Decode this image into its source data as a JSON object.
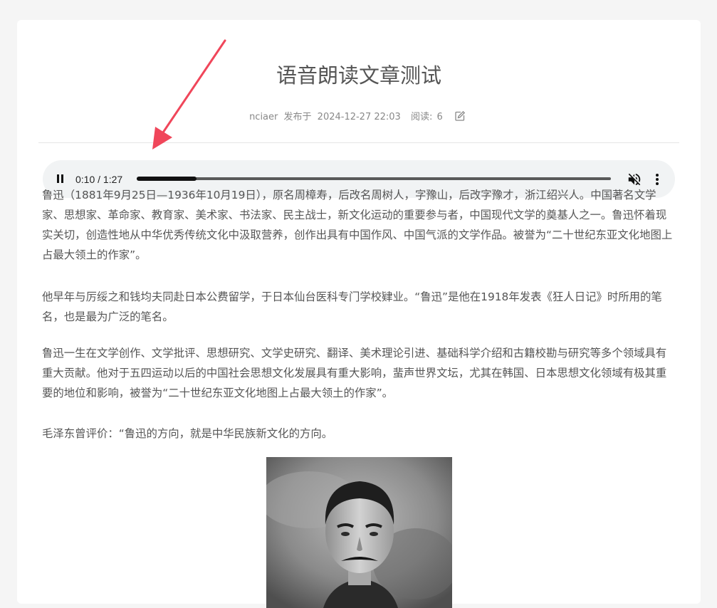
{
  "article": {
    "title": "语音朗读文章测试",
    "author": "nciaer",
    "published_label": "发布于",
    "published_at": "2024-12-27 22:03",
    "views_label": "阅读:",
    "views": "6"
  },
  "audio_player": {
    "time_display": "0:10 / 1:27",
    "progress_fraction": 0.126,
    "state": "playing",
    "muted": true,
    "icons": [
      "pause-icon",
      "muted-speaker-icon",
      "more-vertical-icon"
    ]
  },
  "paragraphs": [
    "鲁迅（1881年9月25日—1936年10月19日），原名周樟寿，后改名周树人，字豫山，后改字豫才，浙江绍兴人。中国著名文学家、思想家、革命家、教育家、美术家、书法家、民主战士，新文化运动的重要参与者，中国现代文学的奠基人之一。鲁迅怀着现实关切，创造性地从中华优秀传统文化中汲取营养，创作出具有中国作风、中国气派的文学作品。被誉为“二十世纪东亚文化地图上占最大领土的作家”。",
    "他早年与厉绥之和钱均夫同赴日本公费留学，于日本仙台医科专门学校肄业。“鲁迅”是他在1918年发表《狂人日记》时所用的笔名，也是最为广泛的笔名。",
    "鲁迅一生在文学创作、文学批评、思想研究、文学史研究、翻译、美术理论引进、基础科学介绍和古籍校勘与研究等多个领域具有重大贡献。他对于五四运动以后的中国社会思想文化发展具有重大影响，蜚声世界文坛，尤其在韩国、日本思想文化领域有极其重要的地位和影响，被誉为“二十世纪东亚文化地图上占最大领土的作家”。",
    "毛泽东曾评价：“鲁迅的方向，就是中华民族新文化的方向。"
  ],
  "colors": {
    "annotation_arrow": "#f0465a",
    "player_background": "#f1f3f4",
    "body_text": "#555555"
  }
}
